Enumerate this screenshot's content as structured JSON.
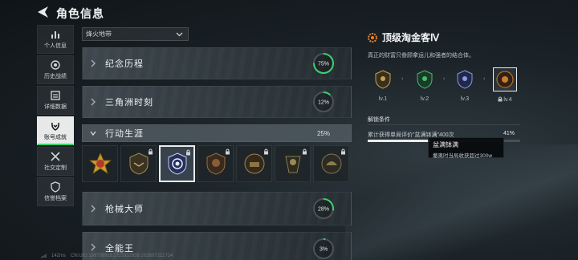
{
  "header": {
    "title": "角色信息"
  },
  "sidebar": {
    "items": [
      {
        "label": "个人信息",
        "icon": "bar-chart-icon",
        "active": false
      },
      {
        "label": "历史战绩",
        "icon": "target-icon",
        "active": false
      },
      {
        "label": "详细数据",
        "icon": "document-icon",
        "active": false
      },
      {
        "label": "账号成就",
        "icon": "laurel-icon",
        "active": true
      },
      {
        "label": "社交定制",
        "icon": "tools-icon",
        "active": false
      },
      {
        "label": "信誉档案",
        "icon": "shield-icon",
        "active": false
      }
    ]
  },
  "season_select": {
    "value": "烽火地带"
  },
  "categories": [
    {
      "label": "纪念历程",
      "progress": "75%",
      "progress_value": 0.75
    },
    {
      "label": "三角洲时刻",
      "progress": "12%",
      "progress_value": 0.12
    },
    {
      "label": "行动生涯",
      "progress": "25%",
      "expanded": true
    },
    {
      "label": "枪械大师",
      "progress": "28%",
      "progress_value": 0.28
    },
    {
      "label": "全能王",
      "progress": "3%",
      "progress_value": 0.03
    }
  ],
  "badges": [
    {
      "name": "gold-cross-medal-icon",
      "locked": false,
      "selected": false
    },
    {
      "name": "eagle-badge-icon",
      "locked": true,
      "selected": false
    },
    {
      "name": "blue-eye-badge-icon",
      "locked": true,
      "selected": true
    },
    {
      "name": "skull-badge-icon",
      "locked": true,
      "selected": false
    },
    {
      "name": "tank-badge-icon",
      "locked": true,
      "selected": false
    },
    {
      "name": "soldier-badge-icon",
      "locked": true,
      "selected": false
    },
    {
      "name": "helmet-badge-icon",
      "locked": true,
      "selected": false
    }
  ],
  "detail": {
    "title": "顶级淘金客Ⅳ",
    "description": "真正的财富只眷顾拿运儿和强者的结合体。",
    "levels": [
      {
        "label": "lv.1",
        "color": "#c8a24a",
        "locked": false
      },
      {
        "label": "lv.2",
        "color": "#3ec06b",
        "locked": false
      },
      {
        "label": "lv.3",
        "color": "#5a6fd0",
        "locked": false
      },
      {
        "label": "lv.4",
        "color": "#d07a2a",
        "locked": true
      }
    ],
    "unlock_title": "解锁条件",
    "condition_text": "累计获得单局评价\"盆满钵满\"400次",
    "condition_pct": "41%",
    "condition_value": 0.41
  },
  "tooltip": {
    "title": "盆满钵满",
    "body": "撤离时当局收获超过300w"
  },
  "footer": {
    "ping": "142ms",
    "uid": "CN:UID:1897999161055932939.202607221724"
  },
  "colors": {
    "accent_green": "#3ccf6a",
    "ring_track": "#4a5358",
    "title_icon": "#e0853a"
  }
}
